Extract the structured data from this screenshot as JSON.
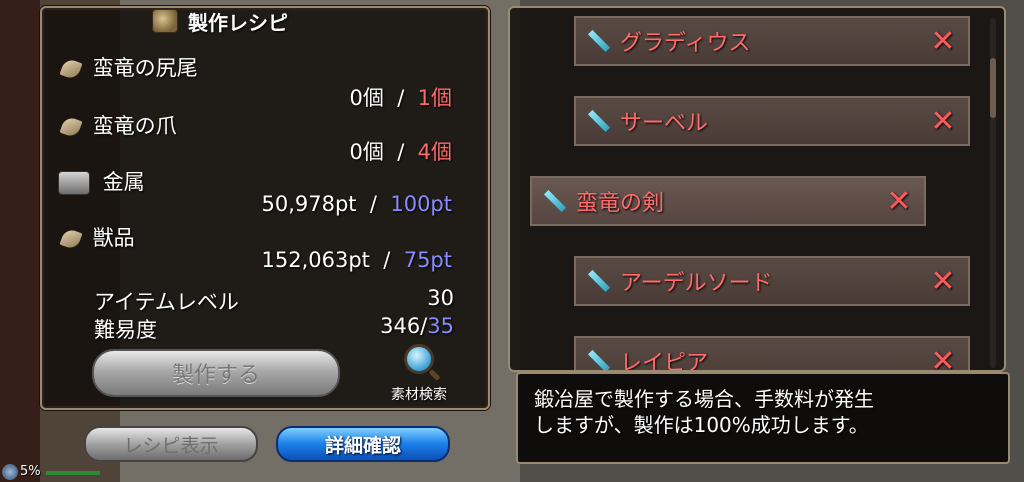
{
  "window": {
    "title": "製作レシピ"
  },
  "materials": [
    {
      "name": "蛮竜の尻尾",
      "have": "0個",
      "sep": "/",
      "need": "1個",
      "icon": "claw-icon"
    },
    {
      "name": "蛮竜の爪",
      "have": "0個",
      "sep": "/",
      "need": "4個",
      "icon": "claw-icon"
    },
    {
      "name": "金属",
      "have": "50,978pt",
      "sep": "/",
      "need": "100pt",
      "icon": "metal-ingot-icon"
    },
    {
      "name": "獣品",
      "have": "152,063pt",
      "sep": "/",
      "need": "75pt",
      "icon": "claw-icon"
    }
  ],
  "stats": {
    "item_level_label": "アイテムレベル",
    "item_level_value": "30",
    "difficulty_label": "難易度",
    "difficulty_current": "346/",
    "difficulty_target": "35"
  },
  "buttons": {
    "craft": "製作する",
    "material_search": "素材検索",
    "recipe_display": "レシピ表示",
    "detail_confirm": "詳細確認"
  },
  "recipe_list": [
    {
      "name": "グラディウス",
      "icon": "sword-icon",
      "remove": "✕"
    },
    {
      "name": "サーベル",
      "icon": "sword-icon",
      "remove": "✕"
    },
    {
      "name": "蛮竜の剣",
      "icon": "sword-icon",
      "remove": "✕",
      "selected": true
    },
    {
      "name": "アーデルソード",
      "icon": "sword-icon",
      "remove": "✕"
    },
    {
      "name": "レイピア",
      "icon": "sword-icon",
      "remove": "✕"
    }
  ],
  "tooltip": {
    "line1": "鍛冶屋で製作する場合、手数料が発生",
    "line2": "しますが、製作は100%成功します。"
  },
  "status": {
    "percent": "5%"
  },
  "colors": {
    "required_red": "#ff6a6a",
    "required_blue": "#8a8aff",
    "accent_blue": "#1a7fe8"
  }
}
